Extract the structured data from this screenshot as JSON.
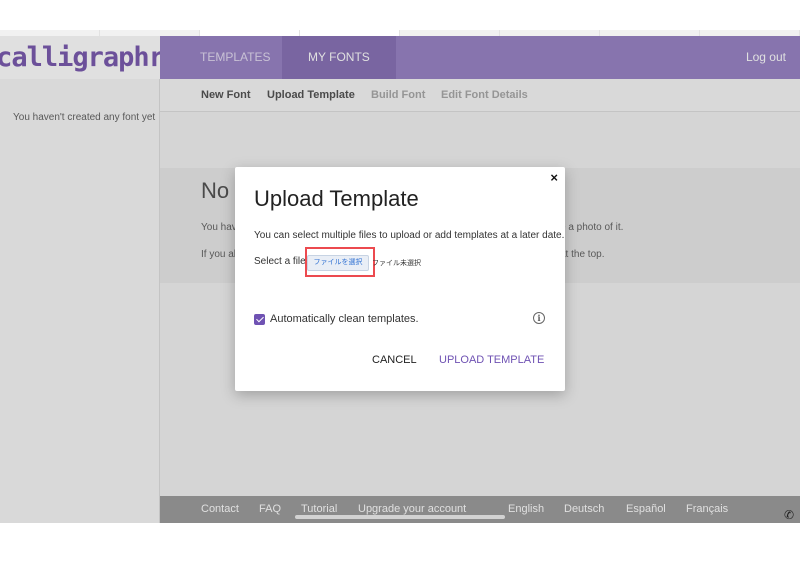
{
  "brand": {
    "logo_text": "calligraphr"
  },
  "header": {
    "nav": [
      {
        "label": "TEMPLATES"
      },
      {
        "label": "MY FONTS"
      }
    ],
    "logout_label": "Log out"
  },
  "subnav": [
    "New Font",
    "Upload Template",
    "Build Font",
    "Edit Font Details"
  ],
  "sidebar": {
    "empty_text": "You haven't created any font yet"
  },
  "content": {
    "title_fragment": "No",
    "line1_fragment": "You hav",
    "line1_tail": "e a photo of it.",
    "line2_fragment": "If you al",
    "line2_tail": "at the top."
  },
  "footer": {
    "links": [
      "Contact",
      "FAQ",
      "Tutorial",
      "Upgrade your account"
    ],
    "languages": [
      "English",
      "Deutsch",
      "Español",
      "Français"
    ]
  },
  "modal": {
    "close_symbol": "×",
    "title": "Upload Template",
    "description": "You can select multiple files to upload or add templates at a later date.",
    "file_label": "Select a file:",
    "file_button": "ファイルを選択",
    "file_status": "ファイル未選択",
    "checkbox_label": "Automatically clean templates.",
    "checkbox_checked": true,
    "info_symbol": "i",
    "cancel_label": "CANCEL",
    "upload_label": "UPLOAD TEMPLATE"
  },
  "icons": {
    "info": "info-icon",
    "close": "close-icon",
    "phone": "phone-icon"
  },
  "phone_symbol": "✆",
  "colors": {
    "brand_purple": "#9a85c6",
    "accent_purple": "#6f52b3",
    "highlight_red": "#ec4a4f"
  }
}
